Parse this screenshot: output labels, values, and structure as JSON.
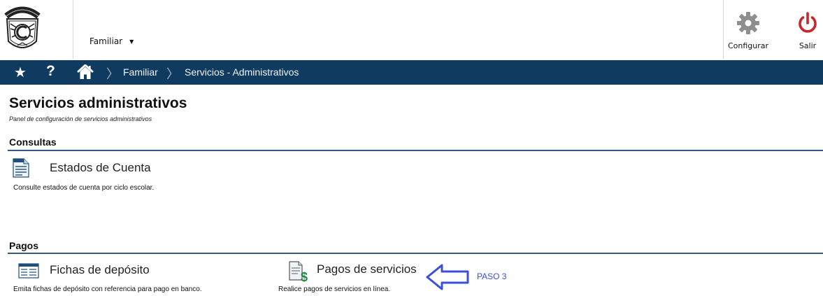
{
  "header": {
    "logo_name": "Colegio Cervantes crest",
    "profile_label": "Familiar",
    "configure_label": "Configurar",
    "exit_label": "Salir"
  },
  "navbar": {
    "breadcrumbs": [
      "Familiar",
      "Servicios - Administrativos"
    ]
  },
  "page": {
    "title": "Servicios administrativos",
    "subtitle": "Panel de configuración de servicios administrativos"
  },
  "sections": {
    "consultas": {
      "title": "Consultas",
      "items": [
        {
          "title": "Estados de Cuenta",
          "description": "Consulte estados de cuenta por ciclo escolar.",
          "icon": "document-icon"
        }
      ]
    },
    "pagos": {
      "title": "Pagos",
      "items": [
        {
          "title": "Fichas de depósito",
          "description": "Emita fichas de depósito con referencia para pago en banco.",
          "icon": "deposit-slip-icon"
        },
        {
          "title": "Pagos de servicios",
          "description": "Realice pagos de servicios en línea.",
          "icon": "payment-icon"
        }
      ]
    }
  },
  "annotation": {
    "label": "PASO 3"
  },
  "colors": {
    "navbar": "#0e3b5f",
    "section_line": "#2f5b87",
    "exit_icon": "#c62828",
    "annotation": "#3b50d8"
  }
}
